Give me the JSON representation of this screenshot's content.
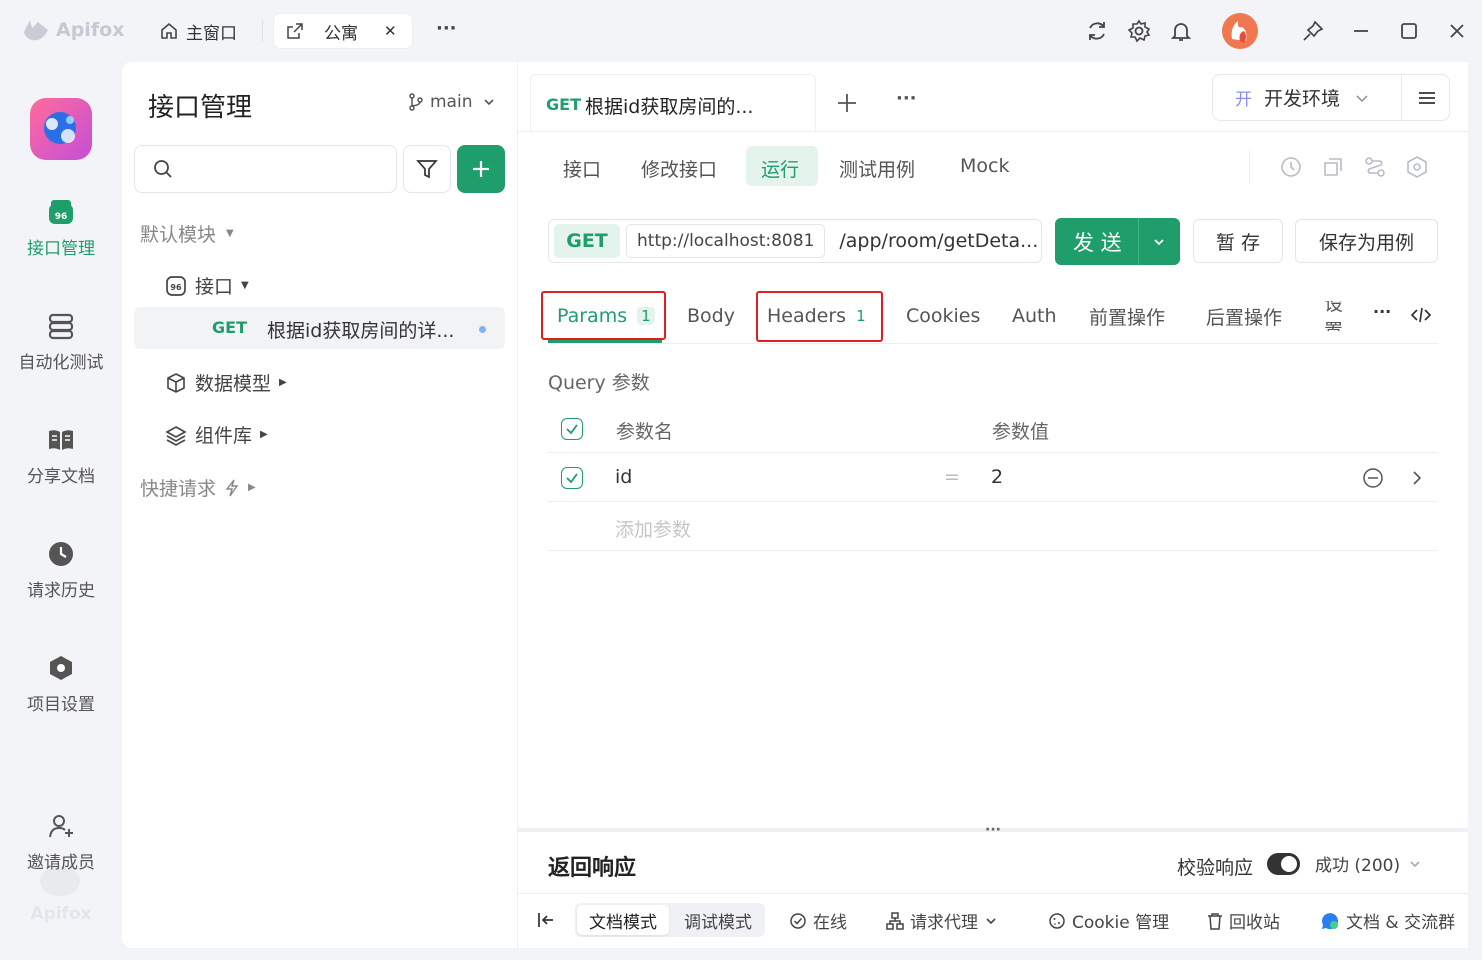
{
  "titlebar": {
    "app_name": "Apifox",
    "tab_main": "主窗口",
    "tab_project": "公寓",
    "close": "✕",
    "more": "···"
  },
  "rail": {
    "items": [
      {
        "label": "接口管理",
        "icon": "api-icon",
        "active": true
      },
      {
        "label": "自动化测试",
        "icon": "automation-icon"
      },
      {
        "label": "分享文档",
        "icon": "book-icon"
      },
      {
        "label": "请求历史",
        "icon": "clock-icon"
      },
      {
        "label": "项目设置",
        "icon": "settings-hex-icon"
      },
      {
        "label": "邀请成员",
        "icon": "add-user-icon"
      }
    ],
    "watermark": "Apifox"
  },
  "sidebar": {
    "title": "接口管理",
    "branch": "main",
    "search_placeholder": "",
    "tree": {
      "default_module": "默认模块",
      "api_folder": "接口",
      "endpoint_method": "GET",
      "endpoint_name": "根据id获取房间的详...",
      "data_models": "数据模型",
      "components": "组件库",
      "quick_request": "快捷请求"
    }
  },
  "main": {
    "open_tab": {
      "method": "GET",
      "title": "根据id获取房间的..."
    },
    "env_prefix": "开",
    "env_name": "开发环境",
    "sub_tabs": [
      "接口",
      "修改接口",
      "运行",
      "测试用例",
      "Mock"
    ],
    "active_sub_tab": "运行",
    "request": {
      "method": "GET",
      "base_url": "http://localhost:8081",
      "path": "/app/room/getDeta...",
      "send": "发 送",
      "save_temp": "暂 存",
      "save_case": "保存为用例"
    },
    "param_tabs": {
      "params": "Params",
      "params_count": "1",
      "body": "Body",
      "headers": "Headers",
      "headers_count": "1",
      "cookies": "Cookies",
      "auth": "Auth",
      "pre": "前置操作",
      "post": "后置操作",
      "settings": "设置"
    },
    "query": {
      "title": "Query 参数",
      "col_name": "参数名",
      "col_value": "参数值",
      "rows": [
        {
          "name": "id",
          "eq": "=",
          "value": "2"
        }
      ],
      "add_placeholder": "添加参数"
    },
    "response": {
      "title": "返回响应",
      "validate_label": "校验响应",
      "status": "成功 (200)"
    }
  },
  "bottom": {
    "doc_mode": "文档模式",
    "debug_mode": "调试模式",
    "online": "在线",
    "proxy": "请求代理",
    "cookie": "Cookie 管理",
    "trash": "回收站",
    "community": "文档 & 交流群"
  },
  "colors": {
    "accent": "#1f9d6b",
    "highlight": "#e02020",
    "bg": "#f3f4f7"
  }
}
